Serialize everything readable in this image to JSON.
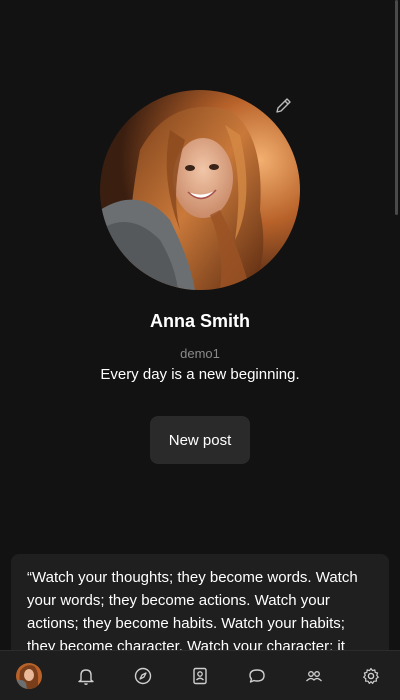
{
  "profile": {
    "name": "Anna Smith",
    "username": "demo1",
    "bio": "Every day is a new beginning.",
    "avatar_icon": "user-photo"
  },
  "actions": {
    "new_post_label": "New post",
    "edit_icon": "pencil-icon"
  },
  "post": {
    "text": "“Watch your thoughts; they become words. Watch your words; they become actions. Watch your actions; they become habits. Watch your habits; they become character. Watch your character; it becomes your destiny.”"
  },
  "nav": {
    "items": [
      "profile-avatar",
      "bell-icon",
      "compass-icon",
      "bookmark-user-icon",
      "chat-icon",
      "group-icon",
      "gear-icon"
    ]
  },
  "colors": {
    "background": "#121212",
    "card": "#1f1f1f",
    "button": "#2a2a2a",
    "muted_text": "#8a8a8a",
    "nav_bar": "#1e1e1e"
  }
}
